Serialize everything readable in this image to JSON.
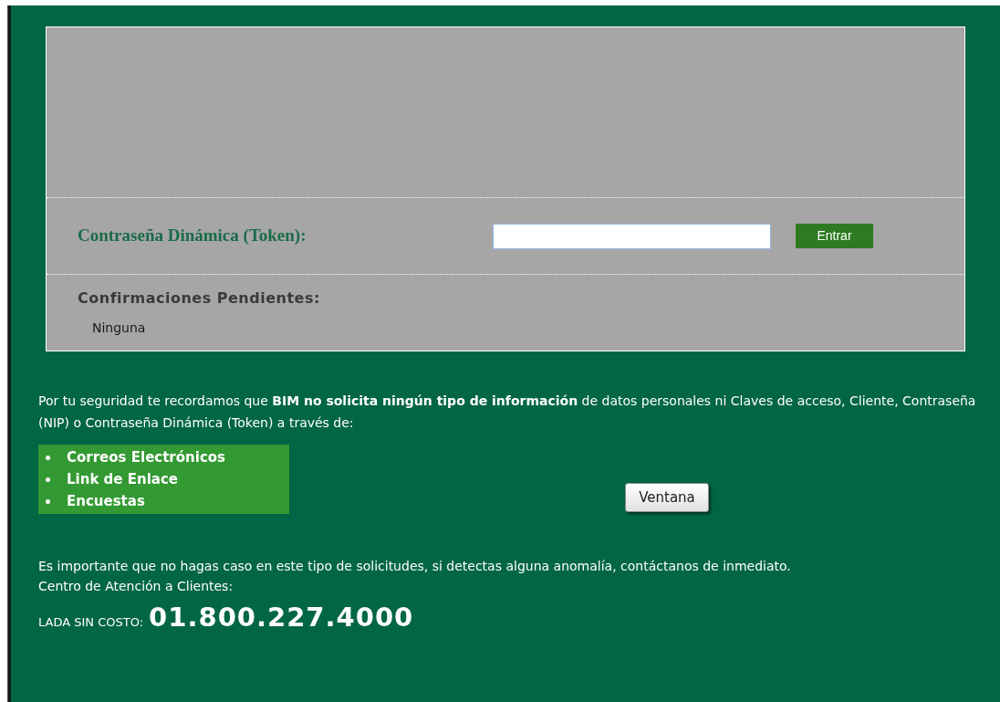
{
  "token_form": {
    "label": "Contraseña Dinámica (Token):",
    "submit": "Entrar"
  },
  "pending": {
    "title": "Confirmaciones Pendientes:",
    "value": "Ninguna"
  },
  "notice": {
    "text": "Por tu seguridad te recordamos que **BIM no solicita ningún tipo de información** de datos personales ni Claves de acceso, Cliente, Contraseña (NIP) o Contraseña Dinámica (Token) a través de:",
    "items": [
      "Correos Electrónicos",
      "Link de Enlace",
      "Encuestas"
    ],
    "window_button": "Ventana"
  },
  "warning": "Es importante que no hagas caso en este tipo de solicitudes, si detectas alguna anomalía, contáctanos de inmediato.",
  "contact": {
    "title": "Centro de Atención a Clientes:",
    "phone_label": "LADA SIN COSTO:",
    "phone": "01.800.227.4000"
  }
}
